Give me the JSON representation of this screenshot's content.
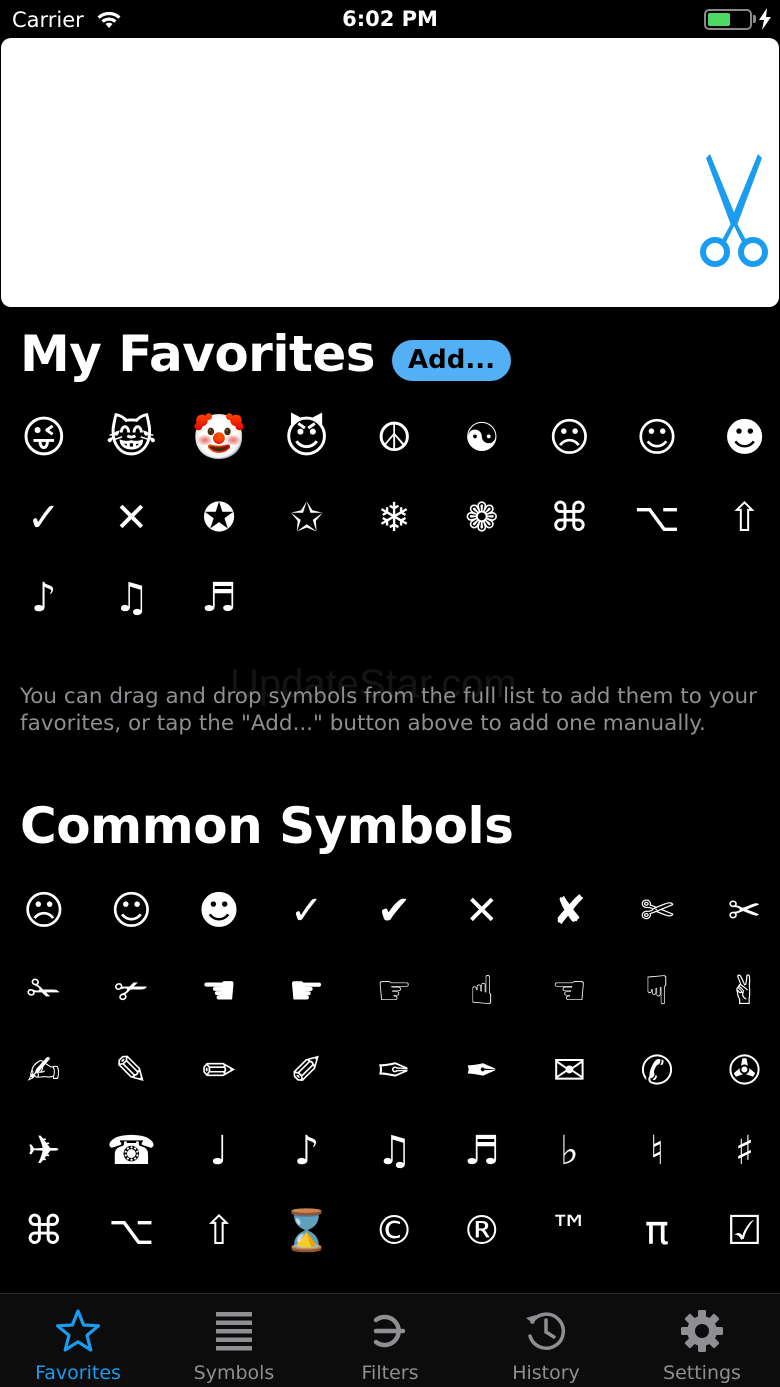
{
  "status_bar": {
    "carrier": "Carrier",
    "time": "6:02 PM",
    "battery_level": 0.55
  },
  "favorites": {
    "title": "My Favorites",
    "add_label": "Add...",
    "symbols": [
      "😜",
      "😹",
      "🤡",
      "😈",
      "☮",
      "☯",
      "☹",
      "☺",
      "☻",
      "✓",
      "✕",
      "✪",
      "✩",
      "❄",
      "❁",
      "⌘",
      "⌥",
      "⇧",
      "♪",
      "♫",
      "♬"
    ],
    "hint": "You can drag and drop symbols from the full list to add them to your favorites, or tap the \"Add...\" button above to add one manually."
  },
  "common": {
    "title": "Common Symbols",
    "symbols": [
      "☹",
      "☺",
      "☻",
      "✓",
      "✔",
      "✕",
      "✘",
      "✄",
      "✂",
      "✁",
      "✃",
      "☚",
      "☛",
      "☞",
      "☝",
      "☜",
      "☟",
      "✌",
      "✍",
      "✎",
      "✏",
      "✐",
      "✑",
      "✒",
      "✉",
      "✆",
      "✇",
      "✈",
      "☎",
      "♩",
      "♪",
      "♫",
      "♬",
      "♭",
      "♮",
      "♯",
      "⌘",
      "⌥",
      "⇧",
      "⌛",
      "©",
      "®",
      "™",
      "π",
      "☑"
    ]
  },
  "watermark": "UpdateStar.com",
  "tabs": [
    {
      "label": "Favorites",
      "icon": "star-icon",
      "active": true
    },
    {
      "label": "Symbols",
      "icon": "list-icon",
      "active": false
    },
    {
      "label": "Filters",
      "icon": "filter-glyph-icon",
      "active": false
    },
    {
      "label": "History",
      "icon": "history-icon",
      "active": false
    },
    {
      "label": "Settings",
      "icon": "gear-icon",
      "active": false
    }
  ],
  "colors": {
    "accent": "#1a9cf0",
    "add_button": "#53b0f5",
    "battery": "#4cd964",
    "hint_text": "#8e8e93"
  }
}
